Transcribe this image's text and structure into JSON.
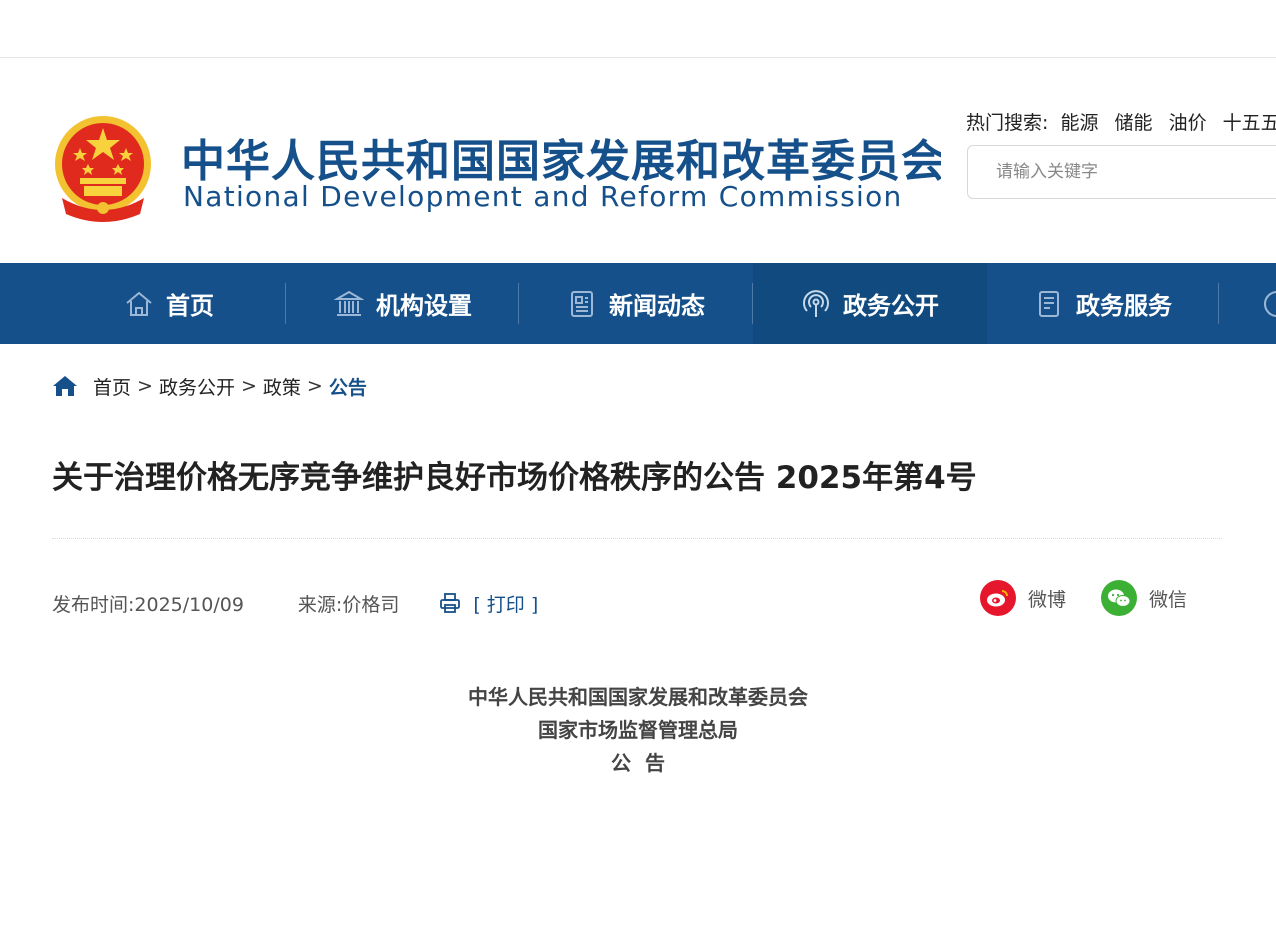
{
  "header": {
    "site_name_cn": "中华人民共和国国家发展和改革委员会",
    "site_name_en": "National Development and Reform Commission",
    "hot_search_label": "热门搜索:",
    "hot_keywords": [
      "能源",
      "储能",
      "油价",
      "十五五"
    ],
    "search_placeholder": "请输入关键字"
  },
  "nav": {
    "items": [
      {
        "label": "首页",
        "icon": "home-icon"
      },
      {
        "label": "机构设置",
        "icon": "building-icon"
      },
      {
        "label": "新闻动态",
        "icon": "news-icon"
      },
      {
        "label": "政务公开",
        "icon": "broadcast-icon",
        "active": true
      },
      {
        "label": "政务服务",
        "icon": "document-icon"
      }
    ]
  },
  "breadcrumb": {
    "items": [
      "首页",
      "政务公开",
      "政策"
    ],
    "current": "公告",
    "separator": ">"
  },
  "article": {
    "title": "关于治理价格无序竞争维护良好市场价格秩序的公告 2025年第4号",
    "publish_time": "发布时间:2025/10/09",
    "source": "来源:价格司",
    "print_label": "[ 打印 ]",
    "share": {
      "weibo": "微博",
      "wechat": "微信"
    },
    "issuers": [
      "中华人民共和国国家发展和改革委员会",
      "国家市场监督管理总局"
    ],
    "doc_type": "公  告"
  },
  "colors": {
    "brand_blue": "#15508a",
    "nav_active": "#104a7e",
    "weibo_red": "#e6162d",
    "wechat_green": "#3cb034"
  }
}
